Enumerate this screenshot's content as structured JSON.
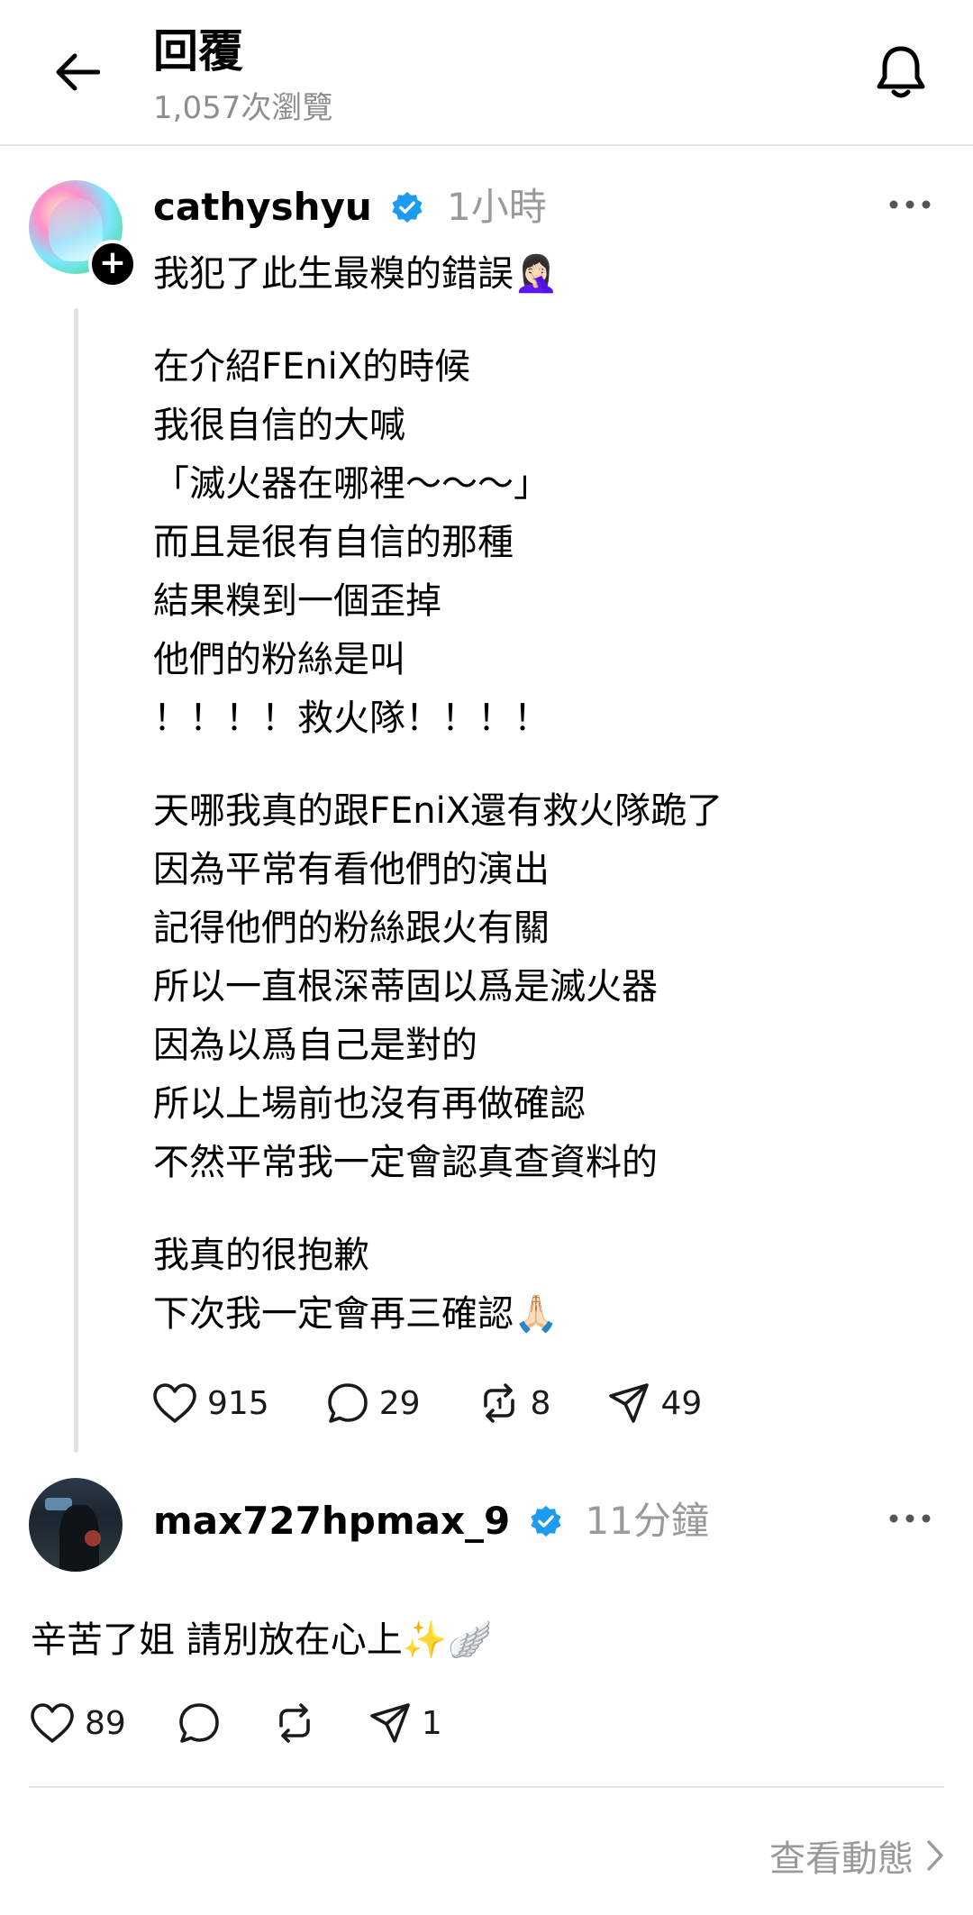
{
  "header": {
    "title": "回覆",
    "views": "1,057次瀏覽"
  },
  "post": {
    "username": "cathyshyu",
    "time": "1小時",
    "first_line": "我犯了此生最糗的錯誤🤦🏻‍♀️",
    "paragraphs": [
      [
        "在介紹FEniX的時候",
        "我很自信的大喊",
        "「滅火器在哪裡〜〜〜」",
        "而且是很有自信的那種",
        "結果糗到一個歪掉",
        "他們的粉絲是叫",
        "！！！！救火隊！！！！"
      ],
      [
        "天哪我真的跟FEniX還有救火隊跪了",
        "因為平常有看他們的演出",
        "記得他們的粉絲跟火有關",
        "所以一直根深蒂固以爲是滅火器",
        "因為以爲自己是對的",
        "所以上場前也沒有再做確認",
        "不然平常我一定會認真查資料的"
      ],
      [
        "我真的很抱歉",
        "下次我一定會再三確認🙏🏻"
      ]
    ],
    "likes": "915",
    "comments": "29",
    "reposts": "8",
    "shares": "49"
  },
  "reply": {
    "username": "max727hpmax_9",
    "time": "11分鐘",
    "text": "辛苦了姐 請別放在心上✨🪽",
    "likes": "89",
    "shares": "1"
  },
  "footer": {
    "view_activity": "查看動態"
  },
  "colors": {
    "verified": "#1d9bf0",
    "muted": "#9a9a9a",
    "divider": "#e6e6e6"
  }
}
